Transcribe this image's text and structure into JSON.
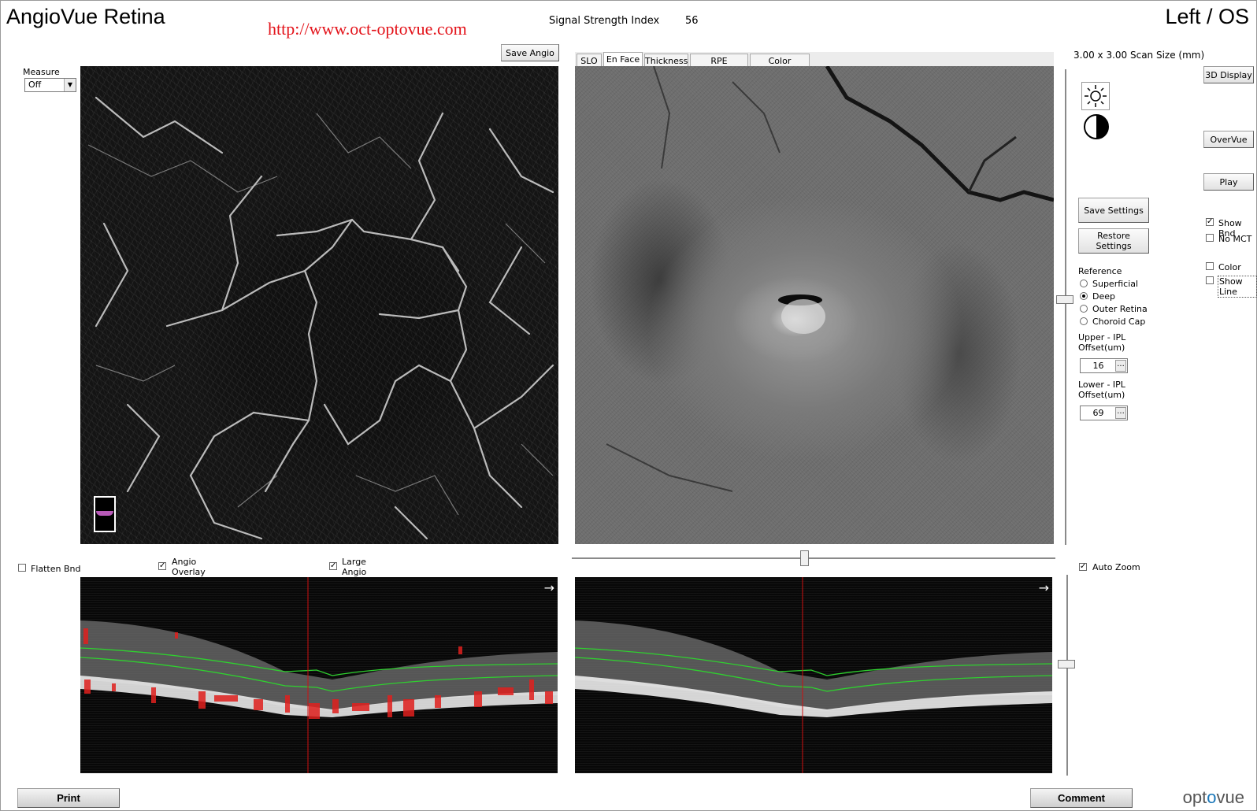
{
  "header": {
    "app_title": "AngioVue Retina",
    "watermark": "http://www.oct-optovue.com",
    "signal_strength_label": "Signal Strength Index",
    "signal_strength_value": "56",
    "eye": "Left / OS"
  },
  "left_panel": {
    "save_angio": "Save Angio",
    "measure_label": "Measure",
    "measure_value": "Off"
  },
  "tabs": [
    {
      "label": "SLO",
      "active": false
    },
    {
      "label": "En Face",
      "active": true
    },
    {
      "label": "Thickness",
      "active": false
    },
    {
      "label": "RPE Elevation",
      "active": false
    },
    {
      "label": "Color Overlay",
      "active": false
    }
  ],
  "right_panel": {
    "scan_size": "3.00 x 3.00 Scan Size (mm)",
    "display_3d": "3D Display",
    "overvue": "OverVue",
    "play": "Play",
    "save_settings": "Save Settings",
    "restore_settings": "Restore Settings",
    "reference_label": "Reference",
    "reference_options": [
      "Superficial",
      "Deep",
      "Outer Retina",
      "Choroid Cap"
    ],
    "reference_selected": "Deep",
    "upper_label_1": "Upper - IPL",
    "upper_label_2": "Offset(um)",
    "upper_value": "16",
    "lower_label_1": "Lower - IPL",
    "lower_label_2": "Offset(um)",
    "lower_value": "69",
    "dots": "...",
    "show_bnd": "Show Bnd",
    "no_mct": "No MCT",
    "color": "Color",
    "show_line": "Show Line",
    "auto_zoom": "Auto Zoom"
  },
  "bottom_options": {
    "flatten_bnd": "Flatten Bnd",
    "angio_overlay_1": "Angio",
    "angio_overlay_2": "Overlay",
    "large_angio_1": "Large",
    "large_angio_2": "Angio"
  },
  "footer": {
    "print": "Print",
    "comment": "Comment",
    "logo_pre": "opt",
    "logo_mid": "o",
    "logo_post": "vue"
  },
  "checkbox_states": {
    "show_bnd": true,
    "no_mct": false,
    "color": false,
    "show_line": false,
    "auto_zoom": true,
    "flatten_bnd": false,
    "angio_overlay": true,
    "large_angio": true
  },
  "colors": {
    "watermark": "#e3141b",
    "segmentation_line": "#2fd02f",
    "angio_overlay": "#e0201e",
    "cursor_line": "#d01010",
    "slab_marker": "#b85ab8",
    "logo_accent": "#1976b8"
  },
  "icons": [
    "brightness-icon",
    "contrast-icon",
    "arrow-right-icon",
    "slab-indicator-icon"
  ]
}
